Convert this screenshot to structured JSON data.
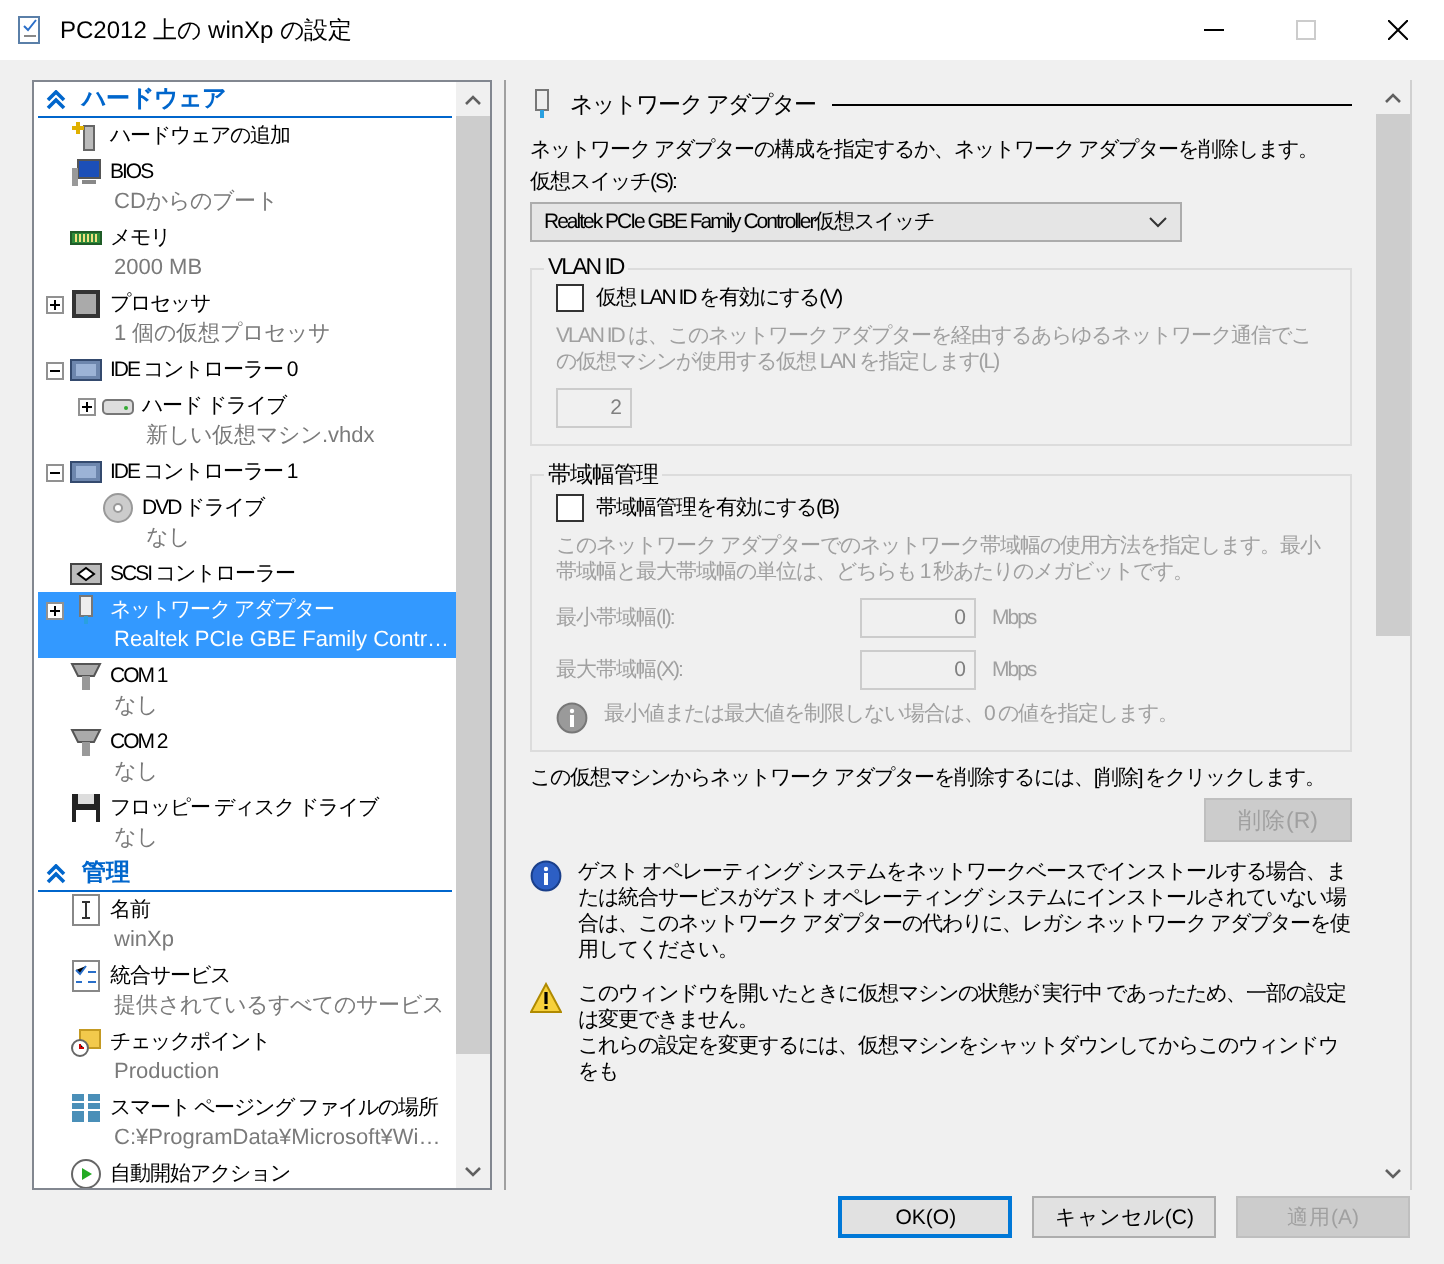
{
  "window": {
    "title": "PC2012 上の winXp の設定"
  },
  "tree": {
    "sections": [
      {
        "title": "ハードウェア",
        "expanded": true,
        "items": [
          {
            "kind": "add-hardware",
            "label": "ハードウェアの追加",
            "selected": false
          },
          {
            "kind": "bios",
            "label": "BIOS",
            "detail": "CDからのブート",
            "selected": false
          },
          {
            "kind": "memory",
            "label": "メモリ",
            "detail": "2000 MB",
            "selected": false
          },
          {
            "kind": "processor",
            "label": "プロセッサ",
            "detail": "1 個の仮想プロセッサ",
            "expanded": false,
            "selected": false
          },
          {
            "kind": "controller",
            "label": "IDE コントローラー 0",
            "expanded": true,
            "selected": false,
            "children": [
              {
                "kind": "hard-drive",
                "label": "ハード ドライブ",
                "detail": "新しい仮想マシン.vhdx",
                "expanded": false,
                "selected": false
              }
            ]
          },
          {
            "kind": "controller",
            "label": "IDE コントローラー 1",
            "expanded": true,
            "selected": false,
            "children": [
              {
                "kind": "dvd",
                "label": "DVD ドライブ",
                "detail": "なし",
                "selected": false
              }
            ]
          },
          {
            "kind": "scsi",
            "label": "SCSI コントローラー",
            "selected": false
          },
          {
            "kind": "network",
            "label": "ネットワーク アダプター",
            "detail": "Realtek PCIe GBE Family Contr…",
            "expanded": false,
            "selected": true
          },
          {
            "kind": "com",
            "label": "COM 1",
            "detail": "なし",
            "selected": false
          },
          {
            "kind": "com",
            "label": "COM 2",
            "detail": "なし",
            "selected": false
          },
          {
            "kind": "floppy",
            "label": "フロッピー ディスク ドライブ",
            "detail": "なし",
            "selected": false
          }
        ]
      },
      {
        "title": "管理",
        "expanded": true,
        "items": [
          {
            "kind": "name",
            "label": "名前",
            "detail": "winXp",
            "selected": false
          },
          {
            "kind": "integration",
            "label": "統合サービス",
            "detail": "提供されているすべてのサービス",
            "selected": false
          },
          {
            "kind": "checkpoint",
            "label": "チェックポイント",
            "detail": "Production",
            "selected": false
          },
          {
            "kind": "paging",
            "label": "スマート ページング ファイルの場所",
            "detail": "C:¥ProgramData¥Microsoft¥Wi…",
            "selected": false
          },
          {
            "kind": "autostart",
            "label": "自動開始アクション",
            "selected": false
          }
        ]
      }
    ]
  },
  "panel": {
    "header": "ネットワーク アダプター",
    "intro": "ネットワーク アダプターの構成を指定するか、ネットワーク アダプターを削除します。",
    "switch_label": "仮想スイッチ(S):",
    "switch_value": "Realtek PCIe GBE Family Controller仮想スイッチ",
    "vlan": {
      "title": "VLAN ID",
      "checkbox": {
        "label": "仮想 LAN ID を有効にする(V)",
        "checked": false
      },
      "description": "VLAN ID は、このネットワーク アダプターを経由するあらゆるネットワーク通信でこの仮想マシンが使用する仮想 LAN を指定します(L)",
      "value": "2",
      "disabled": true
    },
    "bandwidth": {
      "title": "帯域幅管理",
      "checkbox": {
        "label": "帯域幅管理を有効にする(B)",
        "checked": false
      },
      "description": "このネットワーク アダプターでのネットワーク帯域幅の使用方法を指定します。最小帯域幅と最大帯域幅の単位は、どちらも 1 秒あたりのメガビットです。",
      "disabled": true,
      "fields": [
        {
          "label": "最小帯域幅(I):",
          "value": "0",
          "unit": "Mbps"
        },
        {
          "label": "最大帯域幅(X):",
          "value": "0",
          "unit": "Mbps"
        }
      ],
      "note": "最小値または最大値を制限しない場合は、0 の値を指定します。"
    },
    "remove_text": "この仮想マシンからネットワーク アダプターを削除するには、[削除] をクリックします。",
    "remove_button": {
      "label": "削除(R)",
      "disabled": true
    },
    "notes": [
      {
        "kind": "info",
        "paragraphs": [
          "ゲスト オペレーティング システムをネットワークベースでインストールする場合、または統合サービスがゲスト オペレーティング システムにインストールされていない場合は、このネットワーク アダプターの代わりに、レガシ ネットワーク アダプターを使用してください。"
        ]
      },
      {
        "kind": "warning",
        "paragraphs": [
          "このウィンドウを開いたときに仮想マシンの状態が 実行中 であったため、一部の設定は変更できません。",
          "これらの設定を変更するには、仮想マシンをシャットダウンしてからこのウィンドウをも"
        ]
      }
    ]
  },
  "buttons": [
    {
      "label": "OK(O)",
      "default": true,
      "disabled": false
    },
    {
      "label": "キャンセル(C)",
      "default": false,
      "disabled": false
    },
    {
      "label": "適用(A)",
      "default": false,
      "disabled": true
    }
  ]
}
